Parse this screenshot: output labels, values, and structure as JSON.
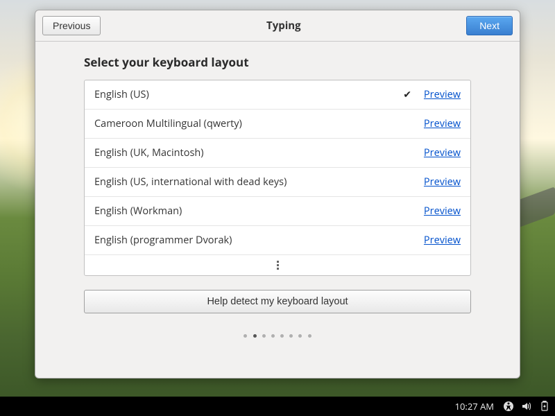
{
  "header": {
    "previous_label": "Previous",
    "title": "Typing",
    "next_label": "Next"
  },
  "main": {
    "section_title": "Select your keyboard layout",
    "layouts": [
      {
        "name": "English (US)",
        "selected": true,
        "preview": "Preview"
      },
      {
        "name": "Cameroon Multilingual (qwerty)",
        "selected": false,
        "preview": "Preview"
      },
      {
        "name": "English (UK, Macintosh)",
        "selected": false,
        "preview": "Preview"
      },
      {
        "name": "English (US, international with dead keys)",
        "selected": false,
        "preview": "Preview"
      },
      {
        "name": "English (Workman)",
        "selected": false,
        "preview": "Preview"
      },
      {
        "name": "English (programmer Dvorak)",
        "selected": false,
        "preview": "Preview"
      }
    ],
    "detect_label": "Help detect my keyboard layout"
  },
  "pager": {
    "count": 8,
    "active": 1
  },
  "taskbar": {
    "time": "10:27 AM"
  }
}
